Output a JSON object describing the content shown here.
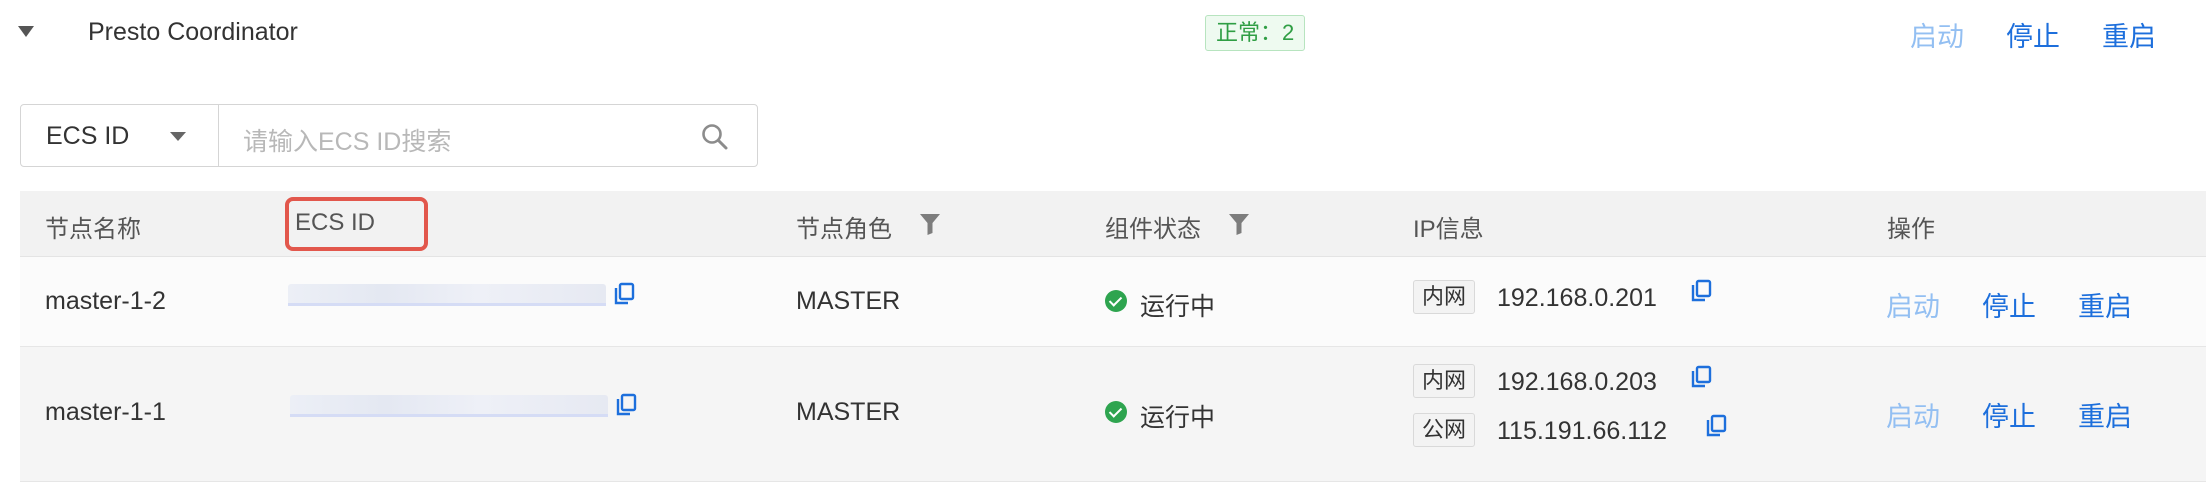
{
  "header": {
    "title": "Presto Coordinator",
    "status_badge": "正常：2",
    "actions": {
      "start": "启动",
      "stop": "停止",
      "restart": "重启"
    }
  },
  "search": {
    "field_selected": "ECS ID",
    "placeholder": "请输入ECS ID搜索"
  },
  "table": {
    "columns": {
      "node_name": "节点名称",
      "ecs_id": "ECS ID",
      "node_role": "节点角色",
      "component_status": "组件状态",
      "ip_info": "IP信息",
      "actions": "操作"
    },
    "rows": [
      {
        "node_name": "master-1-2",
        "role": "MASTER",
        "status": "运行中",
        "ips": [
          {
            "type": "内网",
            "address": "192.168.0.201"
          }
        ],
        "actions": {
          "start": "启动",
          "stop": "停止",
          "restart": "重启"
        }
      },
      {
        "node_name": "master-1-1",
        "role": "MASTER",
        "status": "运行中",
        "ips": [
          {
            "type": "内网",
            "address": "192.168.0.203"
          },
          {
            "type": "公网",
            "address": "115.191.66.112"
          }
        ],
        "actions": {
          "start": "启动",
          "stop": "停止",
          "restart": "重启"
        }
      }
    ]
  },
  "colors": {
    "accent": "#1d6fdc",
    "disabled_link": "#93bff2",
    "success": "#2ea44f",
    "highlight": "#e2574c"
  }
}
